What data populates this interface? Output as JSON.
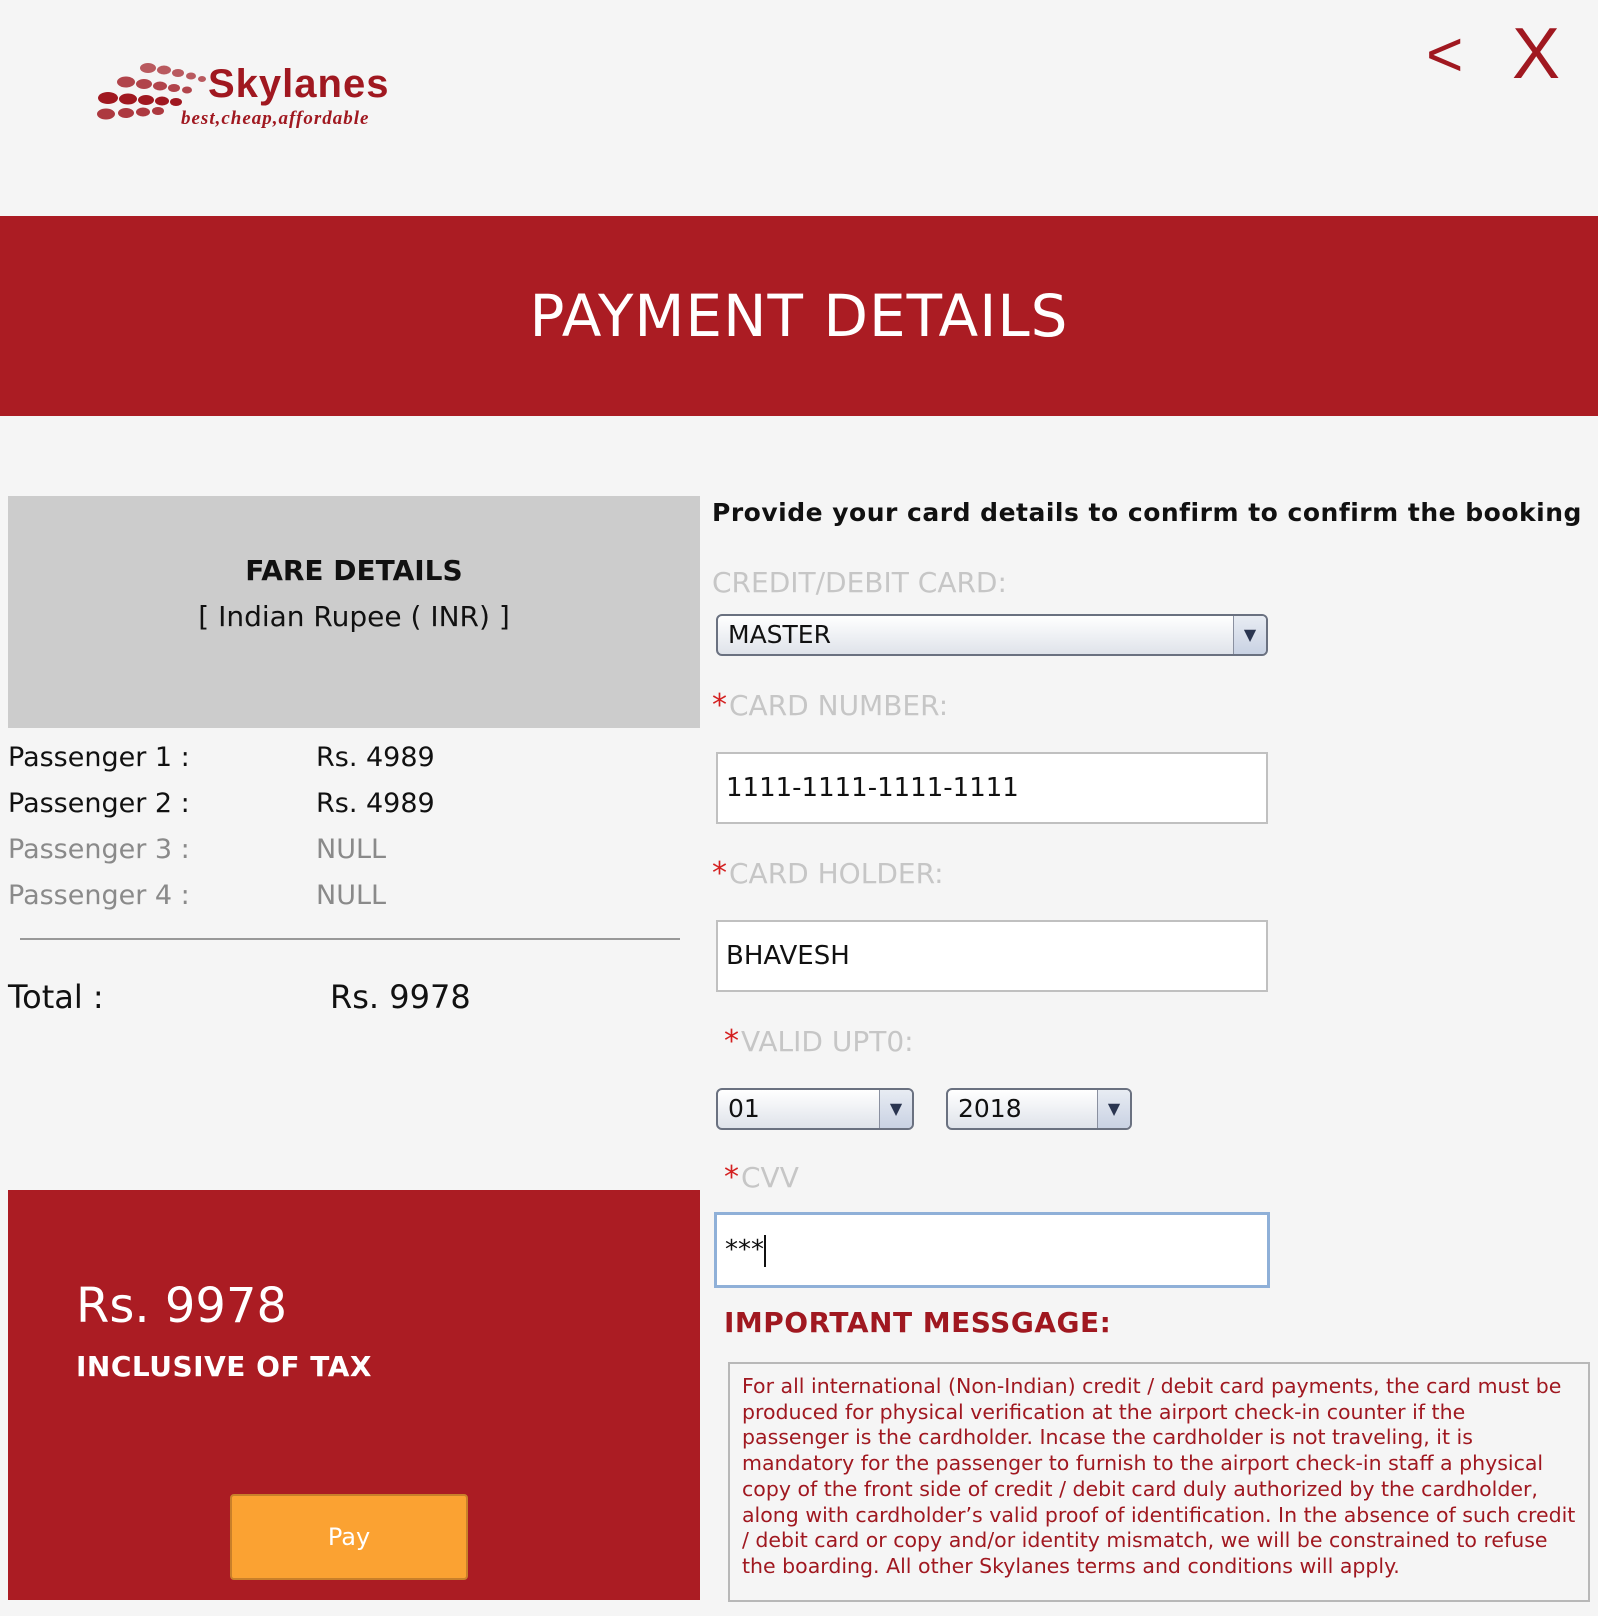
{
  "header": {
    "brand_name": "Skylanes",
    "brand_tagline": "best,cheap,affordable",
    "back_label": "<",
    "close_label": "X",
    "page_title": "PAYMENT DETAILS"
  },
  "fare": {
    "title": "FARE DETAILS",
    "currency": "[ Indian Rupee ( INR) ]",
    "passengers": [
      {
        "label": "Passenger 1 :",
        "value": "Rs. 4989"
      },
      {
        "label": "Passenger 2 :",
        "value": "Rs. 4989"
      },
      {
        "label": "Passenger 3 :",
        "value": "NULL"
      },
      {
        "label": "Passenger 4 :",
        "value": "NULL"
      }
    ],
    "total_label": "Total :",
    "total_value": "Rs. 9978"
  },
  "pay_panel": {
    "amount": "Rs. 9978",
    "tax_note": "INCLUSIVE OF TAX",
    "pay_label": "Pay"
  },
  "form": {
    "intro": "Provide your card details to confirm to confirm the booking",
    "card_type_label": "CREDIT/DEBIT CARD:",
    "card_type_value": "MASTER",
    "card_number_label": "CARD NUMBER:",
    "card_number_value": "1111-1111-1111-1111",
    "card_holder_label": "CARD HOLDER:",
    "card_holder_value": "BHAVESH",
    "valid_label": "VALID UPT0:",
    "valid_month": "01",
    "valid_year": "2018",
    "cvv_label": "CVV",
    "cvv_value": "***",
    "required_mark": "*"
  },
  "message": {
    "title": "IMPORTANT MESSGAGE:",
    "body": "For all international (Non-Indian) credit / debit card payments, the card must be produced for physical verification at the airport check-in counter if the passenger is the cardholder. Incase the cardholder is not traveling, it is mandatory for the passenger to furnish to the airport check-in staff a physical copy of the front side of credit / debit card duly authorized by the cardholder, along with cardholder’s valid proof of identification. In the absence of such credit / debit card or copy and/or identity mismatch, we will be constrained to refuse the boarding. All other Skylanes terms and conditions will apply."
  },
  "colors": {
    "brand_red": "#ab1c23",
    "pay_button": "#fba232",
    "required_mark": "#d42020"
  }
}
